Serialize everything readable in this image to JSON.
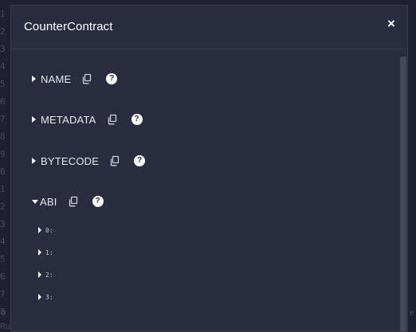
{
  "background": {
    "gutter_numbers": [
      "1",
      "2",
      "3",
      "4",
      "5",
      "6",
      "7",
      "8",
      "9",
      "0",
      "1",
      "2",
      "3",
      "4",
      "5",
      "6",
      "7",
      "8"
    ],
    "status_left": "0",
    "status_bottom": "Ruy",
    "status_right": "e"
  },
  "modal": {
    "title": "CounterContract",
    "close_symbol": "×",
    "sections": [
      {
        "label": "NAME",
        "expanded": false
      },
      {
        "label": "METADATA",
        "expanded": false
      },
      {
        "label": "BYTECODE",
        "expanded": false
      },
      {
        "label": "ABI",
        "expanded": true
      }
    ],
    "abi_items": [
      "0:",
      "1:",
      "2:",
      "3:"
    ],
    "help_symbol": "?"
  },
  "colors": {
    "modal_bg": "#2a2c3f",
    "text": "#ffffff",
    "scrollbar_thumb": "#46485e"
  },
  "icons": {
    "copy": "copy-icon",
    "help": "question-circle-icon",
    "close": "close-icon",
    "caret_right": "caret-right-icon",
    "caret_down": "caret-down-icon"
  }
}
